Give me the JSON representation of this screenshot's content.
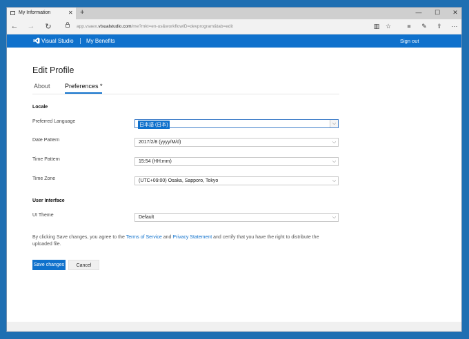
{
  "browser": {
    "tab_title": "My Information",
    "tab_close": "✕",
    "new_tab": "+",
    "win_minimize": "—",
    "win_maximize": "☐",
    "win_close": "✕",
    "url_prefix": "app.vsaex.",
    "url_host": "visualstudio.com",
    "url_path": "/me?mkt=en-us&workflowID=devprogram&tab=edit",
    "icons": {
      "back": "←",
      "forward": "→",
      "refresh": "↻",
      "reading": "▥",
      "favorite": "☆",
      "hub": "≡",
      "notes": "✎",
      "share": "⇧",
      "more": "···"
    }
  },
  "header": {
    "brand": "Visual Studio",
    "benefits": "My Benefits",
    "signout": "Sign out"
  },
  "page": {
    "title": "Edit Profile",
    "tabs": {
      "about": "About",
      "preferences": "Preferences *"
    },
    "locale_section": "Locale",
    "fields": {
      "language": {
        "label": "Preferred Language",
        "value": "日本語 (日本)"
      },
      "date": {
        "label": "Date Pattern",
        "value": "2017/2/8 (yyyy/M/d)"
      },
      "time": {
        "label": "Time Pattern",
        "value": "15:54 (HH:mm)"
      },
      "zone": {
        "label": "Time Zone",
        "value": "(UTC+09:00) Osaka, Sapporo, Tokyo"
      },
      "theme": {
        "label": "UI Theme",
        "value": "Default"
      }
    },
    "ui_section": "User Interface",
    "notice": {
      "pre": "By clicking Save changes, you agree to the ",
      "tos": "Terms of Service",
      "and": " and ",
      "privacy": "Privacy Statement",
      "post": " and certify that you have the right to distribute the uploaded file."
    },
    "save": "Save changes",
    "cancel": "Cancel",
    "chevron": "⌵"
  }
}
